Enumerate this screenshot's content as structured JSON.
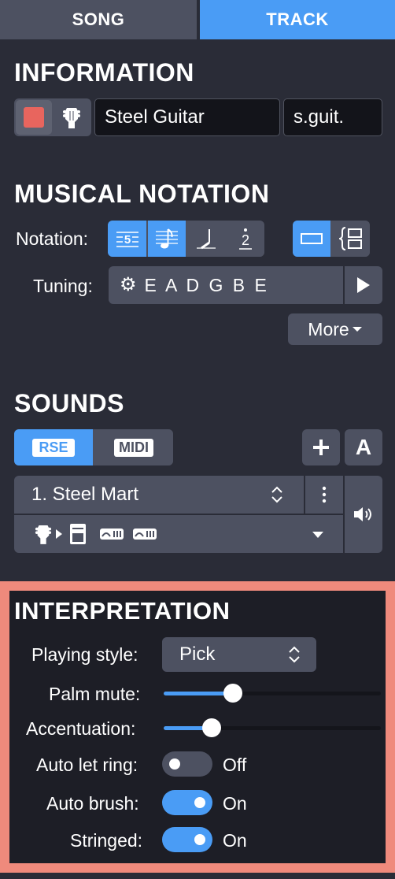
{
  "tabs": [
    {
      "label": "SONG",
      "active": false
    },
    {
      "label": "TRACK",
      "active": true
    }
  ],
  "information": {
    "title": "INFORMATION",
    "color_swatch": "#e8655e",
    "instrument_icon": "guitar-head-icon",
    "track_name": "Steel Guitar",
    "short_name": "s.guit."
  },
  "notation": {
    "title": "MUSICAL NOTATION",
    "notation_label": "Notation:",
    "notation_buttons": [
      {
        "icon": "tablature-icon",
        "text": "5",
        "active": true
      },
      {
        "icon": "standard-notation-icon",
        "active": true
      },
      {
        "icon": "slash-notation-icon",
        "active": false
      },
      {
        "icon": "numbered-notation-icon",
        "text": "2",
        "active": false
      }
    ],
    "layout_buttons": [
      {
        "icon": "single-staff-icon",
        "active": true
      },
      {
        "icon": "multi-staff-icon",
        "active": false
      }
    ],
    "tuning_label": "Tuning:",
    "tuning_value": "E A D G B E",
    "more_label": "More"
  },
  "sounds": {
    "title": "SOUNDS",
    "rse_label": "RSE",
    "midi_label": "MIDI",
    "selected_mode": "RSE",
    "sound_name": "1. Steel Mart",
    "signal_chain": [
      "guitar-head-icon",
      "amp-icon",
      "eq-icon",
      "eq-icon"
    ]
  },
  "interpretation": {
    "title": "INTERPRETATION",
    "playing_style_label": "Playing style:",
    "playing_style_value": "Pick",
    "palm_mute_label": "Palm mute:",
    "palm_mute_value": 0.32,
    "accentuation_label": "Accentuation:",
    "accentuation_value": 0.22,
    "auto_let_ring_label": "Auto let ring:",
    "auto_let_ring_state": "Off",
    "auto_brush_label": "Auto brush:",
    "auto_brush_state": "On",
    "stringed_label": "Stringed:",
    "stringed_state": "On"
  },
  "colors": {
    "accent": "#4a9cf5",
    "panel": "#2a2c37",
    "control": "#4d5161",
    "highlight": "#ef8a7c"
  }
}
